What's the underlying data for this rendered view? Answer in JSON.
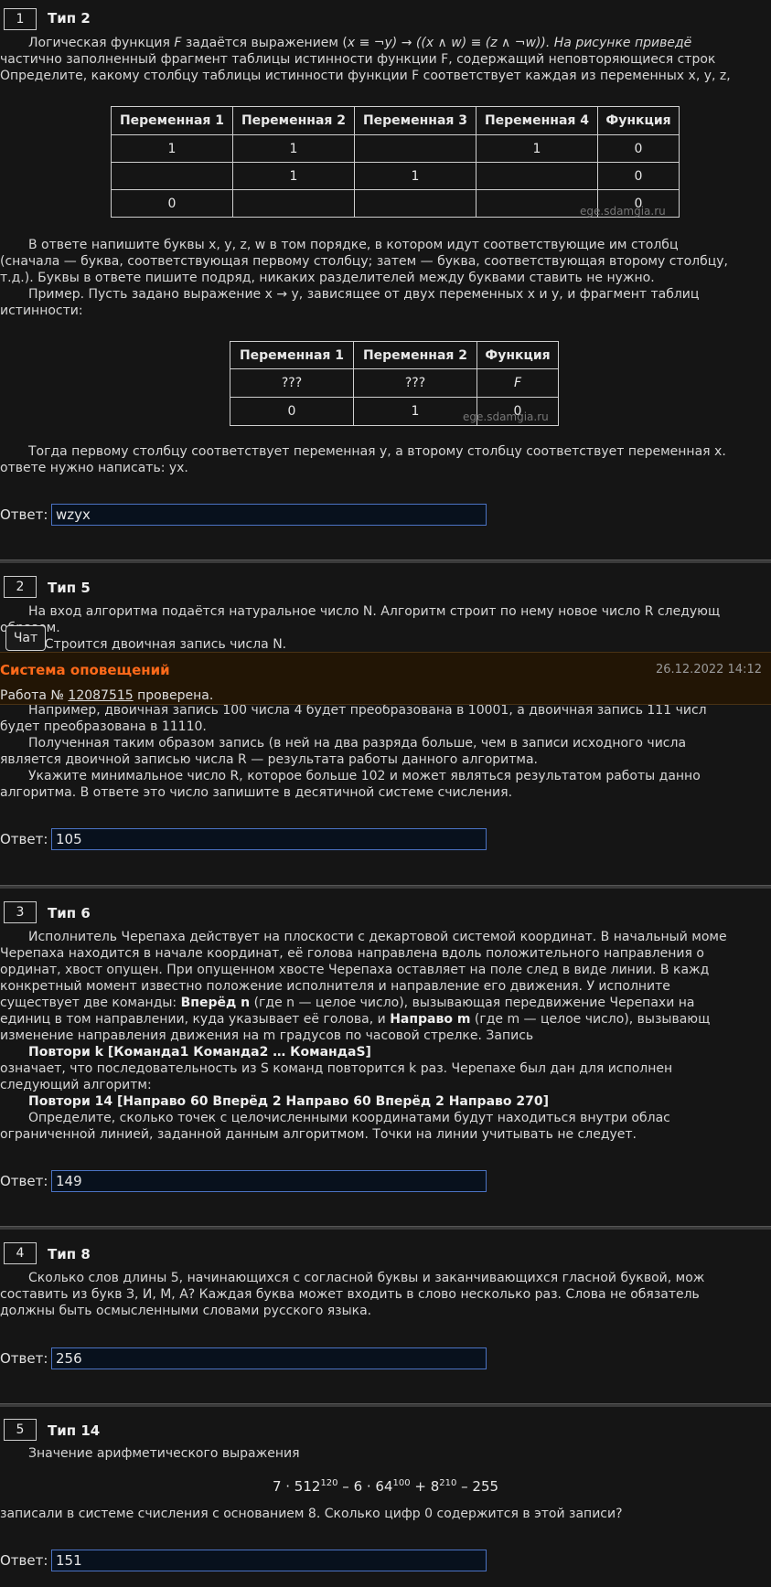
{
  "tasks": [
    {
      "num": "1",
      "type": "Тип 2",
      "p1a": "Логическая функция ",
      "p1b": " задаётся выражением (",
      "p1c": "x ≡ ¬y) → ((x ∧ w) ≡ (z ∧ ¬w)). На рисунке приведё",
      "p2": "частично заполненный фрагмент таблицы истинности функции F, содержащий неповторяющиеся строк",
      "p3": "Определите, какому столбцу таблицы истинности функции F соответствует каждая из переменных x, y, z,",
      "table_headers": [
        "Переменная 1",
        "Переменная 2",
        "Переменная 3",
        "Переменная 4",
        "Функция"
      ],
      "table_rows": [
        [
          "1",
          "1",
          "",
          "1",
          "0"
        ],
        [
          "",
          "1",
          "1",
          "",
          "0"
        ],
        [
          "0",
          "",
          "",
          "",
          "0"
        ]
      ],
      "watermark": "ege.sdamgia.ru",
      "p4": "В ответе напишите буквы x, y, z, w в том порядке, в котором идут соответствующие им столбц",
      "p5": "(сначала — буква, соответствующая первому столбцу; затем — буква, соответствующая второму столбцу,",
      "p6": "т.д.). Буквы в ответе пишите подряд, никаких разделителей между буквами ставить не нужно.",
      "p7": "Пример. Пусть задано выражение x → y, зависящее от двух переменных x и y, и фрагмент таблиц",
      "p8": "истинности:",
      "ex_headers": [
        "Переменная 1",
        "Переменная 2",
        "Функция"
      ],
      "ex_rows": [
        [
          "???",
          "???",
          "F"
        ],
        [
          "0",
          "1",
          "0"
        ]
      ],
      "p9": "Тогда первому столбцу соответствует переменная y, а второму столбцу соответствует переменная x.",
      "p10": "ответе нужно написать: yx.",
      "answer_label": "Ответ:",
      "answer": "wzyx"
    },
    {
      "num": "2",
      "type": "Тип 5",
      "p1": "На вход алгоритма подаётся натуральное число N. Алгоритм строит по нему новое число R следующ",
      "p2": "образом.",
      "p3": "1. Строится двоичная запись числа N.",
      "p4": "Например, двоичная запись 100 числа 4 будет преобразована в 10001, а двоичная запись 111 числ",
      "p5": "будет преобразована в 11110.",
      "p6": "Полученная таким образом запись (в ней на два разряда больше, чем в записи исходного числа",
      "p7": "является двоичной записью числа R — результата работы данного алгоритма.",
      "p8": "Укажите минимальное число R, которое больше 102 и может являться результатом работы данно",
      "p9": "алгоритма. В ответе это число запишите в десятичной системе счисления.",
      "answer_label": "Ответ:",
      "answer": "105"
    },
    {
      "num": "3",
      "type": "Тип 6",
      "p1": "Исполнитель Черепаха действует на плоскости с декартовой системой координат. В начальный моме",
      "p2": "Черепаха находится в начале координат, её голова направлена вдоль положительного направления о",
      "p3": "ординат, хвост опущен. При опущенном хвосте Черепаха оставляет на поле след в виде линии. В кажд",
      "p4": "конкретный момент известно положение исполнителя и направление его движения. У исполните",
      "p5a": "существует две команды: ",
      "p5b": "Вперёд n",
      "p5c": " (где n — целое число), вызывающая передвижение Черепахи на",
      "p6a": "единиц в том направлении, куда указывает её голова, и ",
      "p6b": "Направо m",
      "p6c": " (где m — целое число), вызывающ",
      "p7": "изменение направления движения на m градусов по часовой стрелке. Запись",
      "p8": "Повтори k [Команда1 Команда2 … КомандаS]",
      "p9": "означает, что последовательность из S команд повторится k раз. Черепахе был дан для исполнен",
      "p10": "следующий алгоритм:",
      "p11": "Повтори 14 [Направо 60 Вперёд 2 Направо 60 Вперёд 2 Направо 270]",
      "p12": "Определите, сколько точек с целочисленными координатами будут находиться внутри облас",
      "p13": "ограниченной линией, заданной данным алгоритмом. Точки на линии учитывать не следует.",
      "answer_label": "Ответ:",
      "answer": "149"
    },
    {
      "num": "4",
      "type": "Тип 8",
      "p1": "Сколько слов длины 5, начинающихся с согласной буквы и заканчивающихся гласной буквой, мож",
      "p2": "составить из букв З, И, М, А? Каждая буква может входить в слово несколько раз. Слова не обязатель",
      "p3": "должны быть осмысленными словами русского языка.",
      "answer_label": "Ответ:",
      "answer": "256"
    },
    {
      "num": "5",
      "type": "Тип 14",
      "p1": "Значение арифметического выражения",
      "formula_a": "7 · 512",
      "formula_e1": "120",
      "formula_b": " – 6 · 64",
      "formula_e2": "100",
      "formula_c": " + 8",
      "formula_e3": "210",
      "formula_d": " – 255",
      "p2": "записали в системе счисления с основанием 8. Сколько цифр 0 содержится в этой записи?",
      "answer_label": "Ответ:",
      "answer": "151"
    }
  ],
  "notification": {
    "title": "Система оповещений",
    "date": "26.12.2022 14:12",
    "text_before": "Работа № ",
    "link": "12087515",
    "text_after": " проверена."
  },
  "chat": {
    "label": "Чат"
  }
}
